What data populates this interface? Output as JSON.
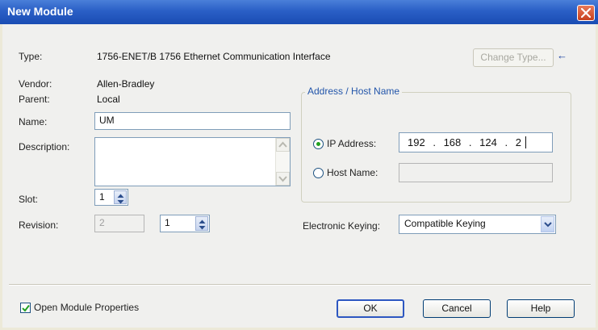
{
  "window": {
    "title": "New Module"
  },
  "form": {
    "type_label": "Type:",
    "type_value": "1756-ENET/B 1756 Ethernet Communication Interface",
    "change_type_label": "Change Type...",
    "change_type_arrow": "←",
    "vendor_label": "Vendor:",
    "vendor_value": "Allen-Bradley",
    "parent_label": "Parent:",
    "parent_value": "Local",
    "name_label": "Name:",
    "name_value": "UM",
    "description_label": "Description:",
    "description_value": "",
    "slot_label": "Slot:",
    "slot_value": "1",
    "revision_label": "Revision:",
    "revision_major": "2",
    "revision_minor": "1"
  },
  "address": {
    "group_title": "Address / Host Name",
    "ip_label": "IP Address:",
    "ip_selected": true,
    "ip_octets": [
      "192",
      "168",
      "124",
      "2"
    ],
    "ip_dots": [
      ".",
      ".",
      "."
    ],
    "host_label": "Host Name:",
    "host_value": ""
  },
  "keying": {
    "label": "Electronic Keying:",
    "selected": "Compatible Keying"
  },
  "footer": {
    "open_props_label": "Open Module Properties",
    "open_props_checked": true,
    "ok_label": "OK",
    "cancel_label": "Cancel",
    "help_label": "Help"
  },
  "colors": {
    "titlebar": "#2a5fc6",
    "group_title": "#2255aa",
    "check_green": "#21a121"
  }
}
